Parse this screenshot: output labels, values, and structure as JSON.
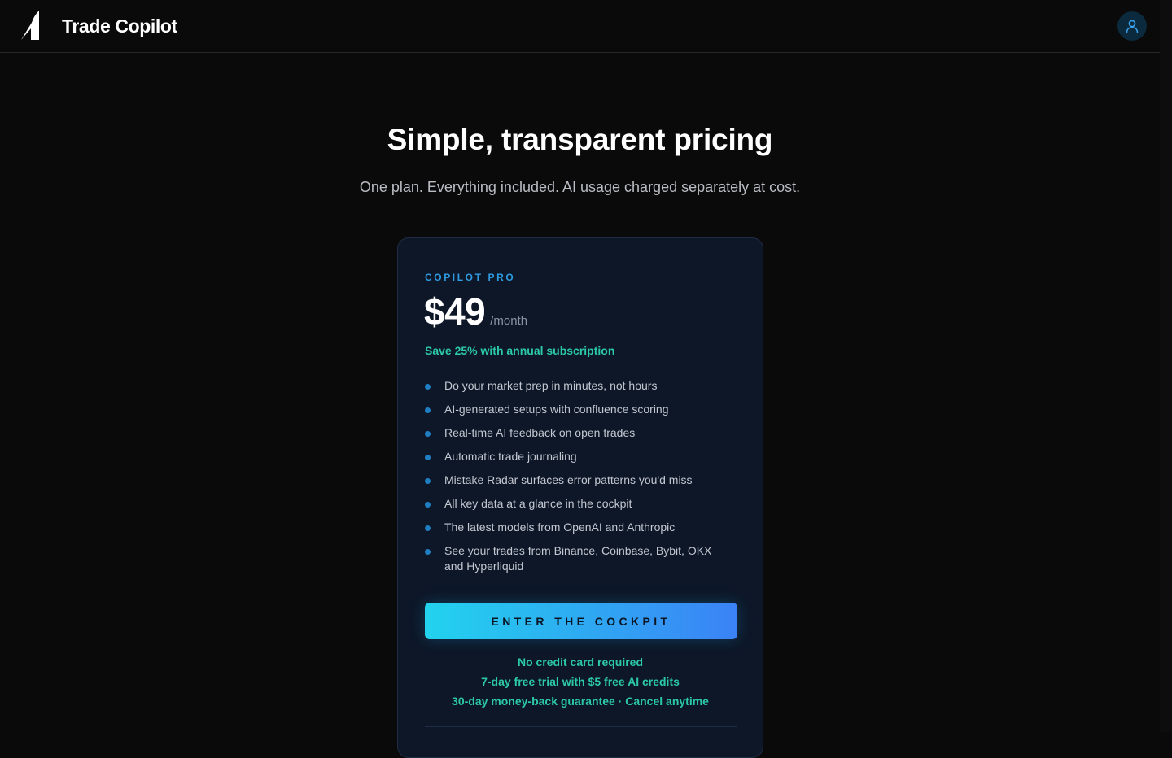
{
  "header": {
    "brand": "Trade Copilot",
    "logo_icon": "rocket-fin-icon",
    "account_icon": "user-icon"
  },
  "hero": {
    "title": "Simple, transparent pricing",
    "subtitle": "One plan. Everything included. AI usage charged separately at cost."
  },
  "plan": {
    "name": "COPILOT PRO",
    "price": "$49",
    "period": "/month",
    "savings": "Save 25% with annual subscription",
    "features": [
      "Do your market prep in minutes, not hours",
      "AI-generated setups with confluence scoring",
      "Real-time AI feedback on open trades",
      "Automatic trade journaling",
      "Mistake Radar surfaces error patterns you'd miss",
      "All key data at a glance in the cockpit",
      "The latest models from OpenAI and Anthropic",
      "See your trades from Binance, Coinbase, Bybit, OKX and Hyperliquid"
    ],
    "cta_label": "ENTER THE COCKPIT",
    "notes": [
      "No credit card required",
      "7-day free trial with $5 free AI credits",
      "30-day money-back guarantee · Cancel anytime"
    ]
  },
  "colors": {
    "background": "#0a0a0b",
    "card": "#0d1728",
    "accent_blue": "#2f9be0",
    "accent_green": "#2cc9a5",
    "cta_gradient_start": "#22d3ee",
    "cta_gradient_end": "#3b82f6"
  }
}
